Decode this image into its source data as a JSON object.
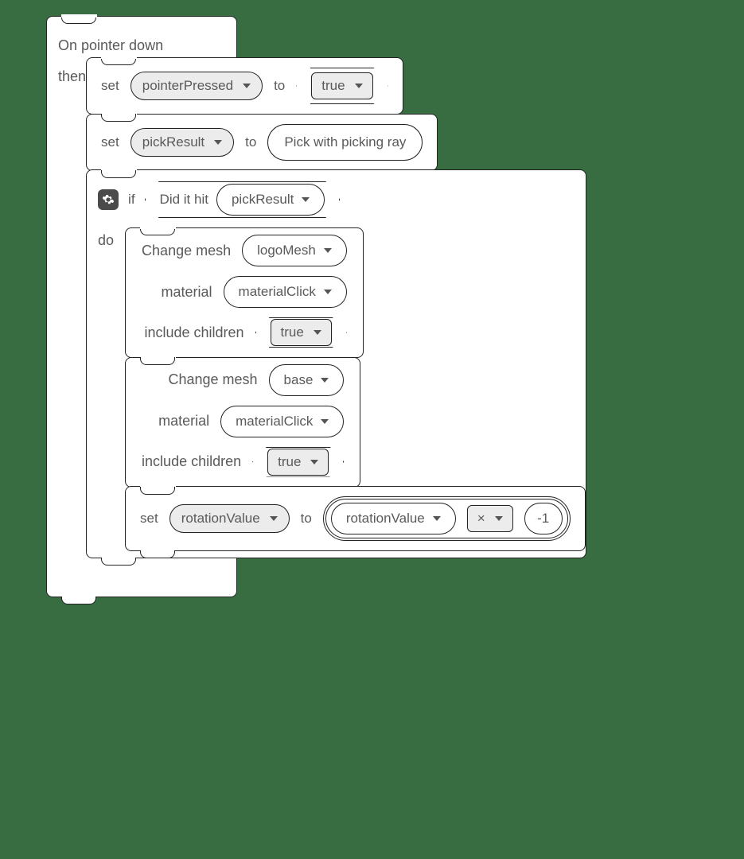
{
  "event": {
    "title": "On pointer down",
    "then_label": "then"
  },
  "stmt_set1": {
    "set_label": "set",
    "var": "pointerPressed",
    "to_label": "to",
    "value": "true"
  },
  "stmt_set2": {
    "set_label": "set",
    "var": "pickResult",
    "to_label": "to",
    "value_label": "Pick with picking ray"
  },
  "if_block": {
    "if_label": "if",
    "hit_label": "Did it hit",
    "hit_var": "pickResult",
    "do_label": "do"
  },
  "change_mesh_1": {
    "title": "Change mesh",
    "mesh_var": "logoMesh",
    "material_label": "material",
    "material_var": "materialClick",
    "include_label": "include children",
    "include_val": "true"
  },
  "change_mesh_2": {
    "title": "Change mesh",
    "mesh_var": "base",
    "material_label": "material",
    "material_var": "materialClick",
    "include_label": "include children",
    "include_val": "true"
  },
  "stmt_set3": {
    "set_label": "set",
    "var": "rotationValue",
    "to_label": "to",
    "left_var": "rotationValue",
    "op": "×",
    "right": "-1"
  }
}
